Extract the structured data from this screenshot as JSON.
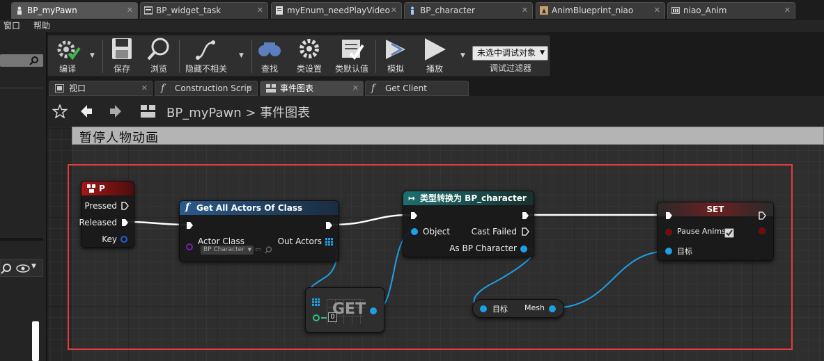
{
  "doc_tabs": [
    {
      "label": "BP_myPawn",
      "icon": "blueprint-pawn-icon"
    },
    {
      "label": "BP_widget_task",
      "icon": "widget-blueprint-icon"
    },
    {
      "label": "myEnum_needPlayVideo",
      "icon": "enum-document-icon"
    },
    {
      "label": "BP_character",
      "icon": "blueprint-character-icon"
    },
    {
      "label": "AnimBlueprint_niao",
      "icon": "anim-blueprint-icon"
    },
    {
      "label": "niao_Anim",
      "icon": "anim-sequence-icon"
    }
  ],
  "menu": {
    "window": "窗口",
    "help": "帮助"
  },
  "toolbar": {
    "compile": "编译",
    "save": "保存",
    "browse": "浏览",
    "hide_unrelated": "隐藏不相关",
    "find": "查找",
    "class_settings": "类设置",
    "class_defaults": "类默认值",
    "simulate": "模拟",
    "play": "播放",
    "debug_object": "未选中调试对象",
    "debug_filter": "调试过滤器"
  },
  "graph_tabs": [
    {
      "label": "视口"
    },
    {
      "label": "Construction Scrip"
    },
    {
      "label": "事件图表"
    },
    {
      "label": "Get Client"
    }
  ],
  "breadcrumb": {
    "blueprint": "BP_myPawn",
    "separator": ">",
    "graph": "事件图表"
  },
  "comment": {
    "title": "暂停人物动画"
  },
  "nodes": {
    "key_event": {
      "title": "P",
      "pressed": "Pressed",
      "released": "Released",
      "key": "Key"
    },
    "get_all_actors": {
      "title": "Get All Actors Of Class",
      "actor_class": "Actor Class",
      "actor_class_value": "BP Character",
      "out_actors": "Out Actors"
    },
    "get_array": {
      "title": "GET",
      "index": "0"
    },
    "cast": {
      "title": "类型转换为 BP_character",
      "object": "Object",
      "cast_failed": "Cast Failed",
      "as_bp_character": "As BP Character"
    },
    "mesh_getter": {
      "target": "目标",
      "mesh": "Mesh"
    },
    "set_node": {
      "title": "SET",
      "pause_anims": "Pause Anims",
      "pause_anims_checked": true,
      "target": "目标"
    }
  },
  "colors": {
    "highlight": "#e03c3c",
    "exec_wire": "#ffffff",
    "object_wire": "#1ea0e6",
    "class_pin": "#7a1fa8",
    "bool_pin": "#8c0000",
    "function_header": "#2a5a8a",
    "event_header": "#8a1515",
    "cast_header": "#1d6f6f",
    "set_header": "#6a2020"
  }
}
